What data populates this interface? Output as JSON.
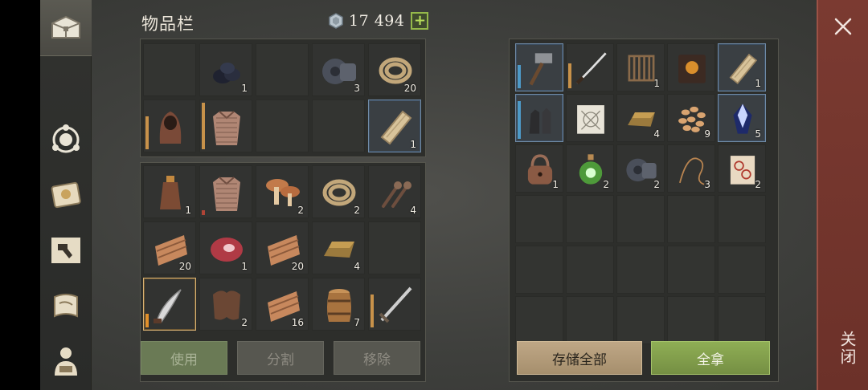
{
  "inventory": {
    "title": "物品栏",
    "currency": {
      "amount": "17 494",
      "add_label": "+"
    },
    "top_grid": [
      {
        "icon": "empty-slot-icon",
        "count": ""
      },
      {
        "icon": "coal-icon",
        "count": "1"
      },
      {
        "icon": "empty-slot-icon",
        "count": ""
      },
      {
        "icon": "gear-part-icon",
        "count": "3"
      },
      {
        "icon": "rope-icon",
        "count": "20"
      },
      {
        "icon": "hood-icon",
        "count": ""
      },
      {
        "icon": "chainmail-icon",
        "count": ""
      },
      {
        "icon": "empty-slot-icon",
        "count": ""
      },
      {
        "icon": "empty-slot-icon",
        "count": ""
      },
      {
        "icon": "plank-icon",
        "count": "1"
      }
    ],
    "bottom_grid": [
      {
        "icon": "flask-icon",
        "count": "1"
      },
      {
        "icon": "chainmail-icon",
        "count": ""
      },
      {
        "icon": "mushroom-icon",
        "count": "2"
      },
      {
        "icon": "rope-icon",
        "count": "2"
      },
      {
        "icon": "nails-icon",
        "count": "4"
      },
      {
        "icon": "fabric-icon",
        "count": "20"
      },
      {
        "icon": "raw-meat-icon",
        "count": "1"
      },
      {
        "icon": "fabric-icon",
        "count": "20"
      },
      {
        "icon": "ingot-icon",
        "count": "4"
      },
      {
        "icon": "empty-slot-icon",
        "count": ""
      },
      {
        "icon": "curved-blade-icon",
        "count": ""
      },
      {
        "icon": "leather-icon",
        "count": "2"
      },
      {
        "icon": "fabric-icon",
        "count": "16"
      },
      {
        "icon": "barrel-icon",
        "count": "7"
      },
      {
        "icon": "sword-icon",
        "count": ""
      }
    ],
    "buttons": {
      "use": "使用",
      "split": "分割",
      "remove": "移除"
    }
  },
  "storage": {
    "grid": [
      {
        "icon": "hammer-icon",
        "count": ""
      },
      {
        "icon": "katana-icon",
        "count": ""
      },
      {
        "icon": "loom-icon",
        "count": "1"
      },
      {
        "icon": "book-icon",
        "count": ""
      },
      {
        "icon": "plank-icon",
        "count": "1"
      },
      {
        "icon": "gloves-icon",
        "count": ""
      },
      {
        "icon": "blueprint-icon",
        "count": ""
      },
      {
        "icon": "ingot-icon",
        "count": "4"
      },
      {
        "icon": "seeds-icon",
        "count": "9"
      },
      {
        "icon": "crystal-icon",
        "count": "5"
      },
      {
        "icon": "padlock-icon",
        "count": "1"
      },
      {
        "icon": "potion-icon",
        "count": "2"
      },
      {
        "icon": "gear-part-icon",
        "count": "2"
      },
      {
        "icon": "wire-icon",
        "count": "3"
      },
      {
        "icon": "scroll-icon",
        "count": "2"
      }
    ],
    "buttons": {
      "store_all": "存储全部",
      "take_all": "全拿"
    }
  },
  "close": {
    "label": "关闭"
  },
  "colors": {
    "accent_green": "#8fae55",
    "close_red": "#7b3a31"
  }
}
